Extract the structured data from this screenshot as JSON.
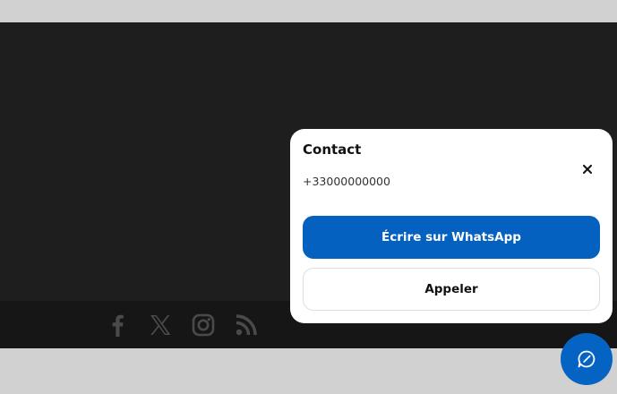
{
  "social": {
    "icons": [
      "facebook-icon",
      "x-icon",
      "instagram-icon",
      "rss-icon"
    ],
    "icon_color": "#4a4a4a"
  },
  "popup": {
    "title": "Contact",
    "phone": "+33000000000",
    "close_icon": "close-icon",
    "whatsapp_label": "Écrire sur WhatsApp",
    "call_label": "Appeler"
  },
  "fab": {
    "icon": "chat-bubble-icon"
  },
  "colors": {
    "page_background": "#d1d1d1",
    "dark_section": "#1e1e1e",
    "footer": "#161616",
    "primary_button": "#0561bf",
    "fab": "#0563c4"
  }
}
